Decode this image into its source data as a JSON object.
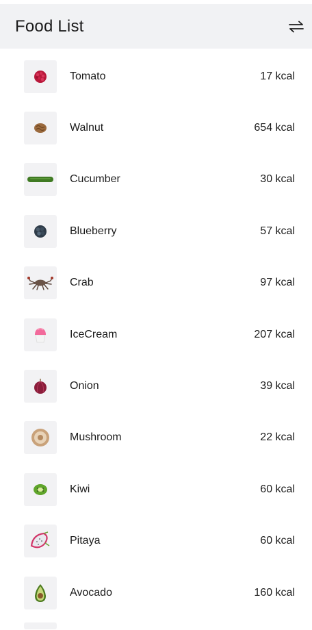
{
  "header": {
    "title": "Food List",
    "sort_icon": "swap-arrows-icon"
  },
  "foods": [
    {
      "name": "Tomato",
      "kcal": "17 kcal",
      "icon": "tomato-icon"
    },
    {
      "name": "Walnut",
      "kcal": "654 kcal",
      "icon": "walnut-icon"
    },
    {
      "name": "Cucumber",
      "kcal": "30 kcal",
      "icon": "cucumber-icon"
    },
    {
      "name": "Blueberry",
      "kcal": "57 kcal",
      "icon": "blueberry-icon"
    },
    {
      "name": "Crab",
      "kcal": "97 kcal",
      "icon": "crab-icon"
    },
    {
      "name": "IceCream",
      "kcal": "207 kcal",
      "icon": "icecream-icon"
    },
    {
      "name": "Onion",
      "kcal": "39 kcal",
      "icon": "onion-icon"
    },
    {
      "name": "Mushroom",
      "kcal": "22 kcal",
      "icon": "mushroom-icon"
    },
    {
      "name": "Kiwi",
      "kcal": "60 kcal",
      "icon": "kiwi-icon"
    },
    {
      "name": "Pitaya",
      "kcal": "60 kcal",
      "icon": "pitaya-icon"
    },
    {
      "name": "Avocado",
      "kcal": "160 kcal",
      "icon": "avocado-icon"
    }
  ],
  "colors": {
    "header_bg": "#f1f2f4",
    "thumb_bg": "#f2f2f4",
    "text": "#1b1b1b"
  }
}
